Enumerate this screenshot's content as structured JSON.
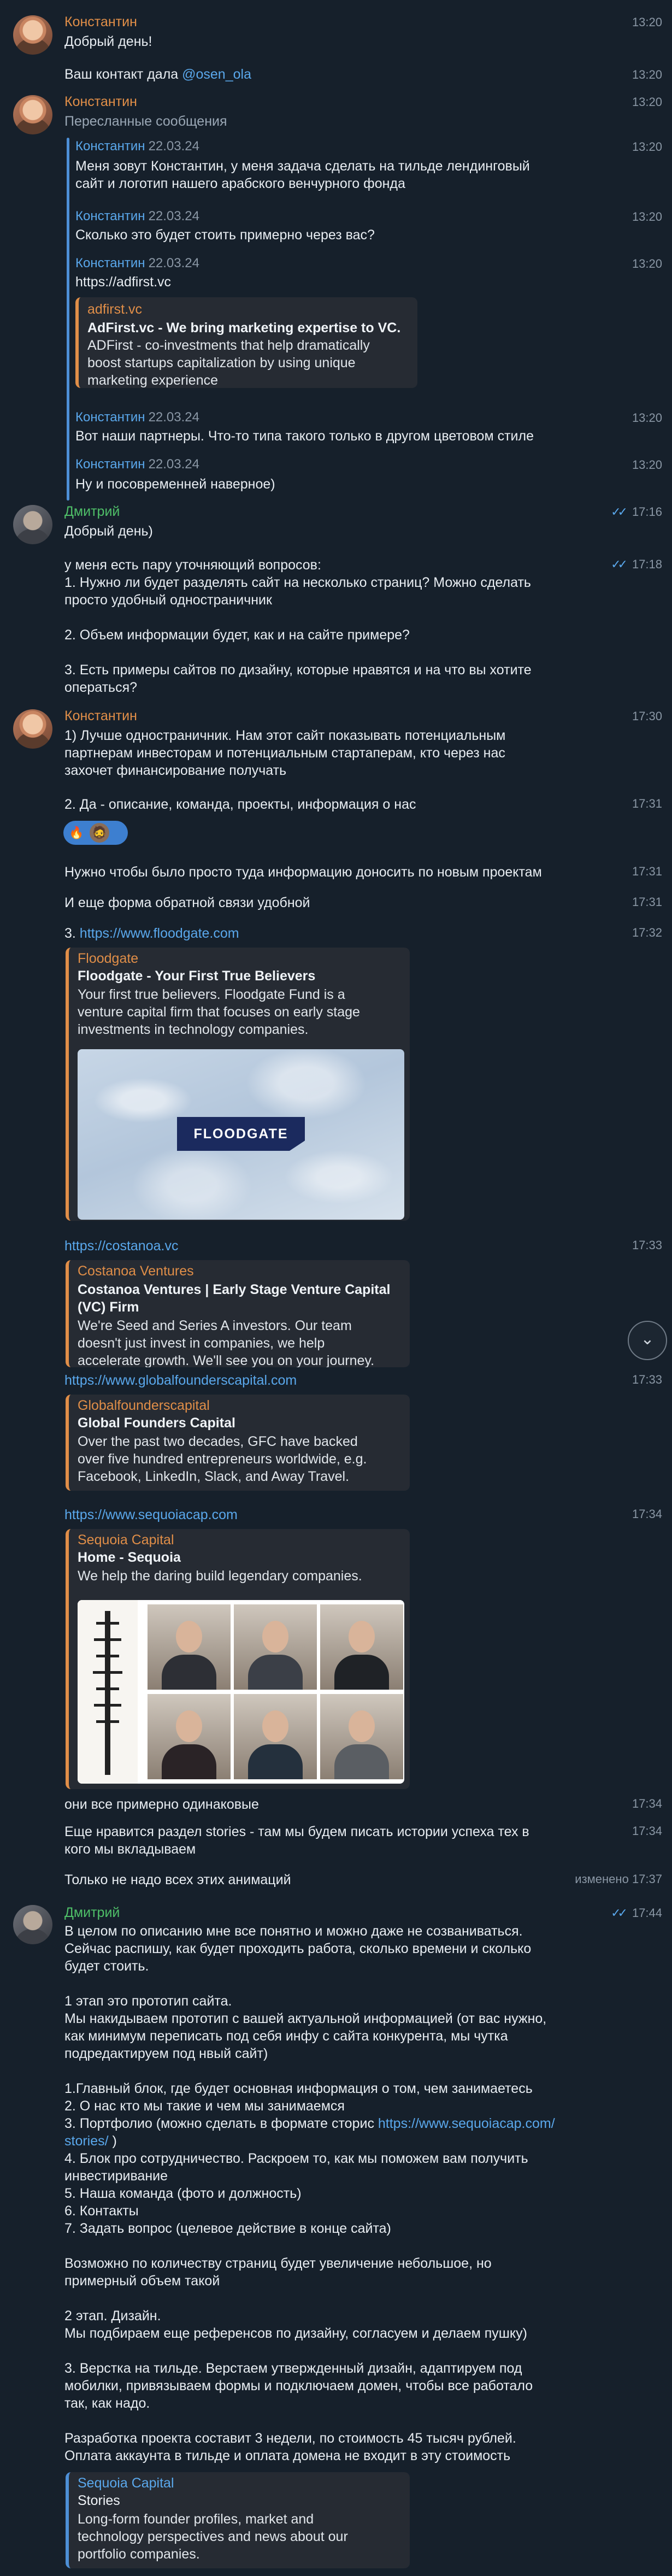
{
  "messages": {
    "m1": {
      "sender": "Константин",
      "time": "13:20",
      "text": "Добрый день!"
    },
    "m2": {
      "prefix": "Ваш контакт дала ",
      "link": "@osen_ola",
      "time": "13:20"
    },
    "m3": {
      "sender": "Константин",
      "time": "13:20",
      "subtitle": "Пересланные сообщения",
      "forwards": [
        {
          "name": "Константин",
          "date": "22.03.24",
          "time": "13:20",
          "text": "Меня зовут Константин, у меня задача сделать на тильде лендинговый\nсайт и логотип нашего арабского венчурного фонда"
        },
        {
          "name": "Константин",
          "date": "22.03.24",
          "time": "13:20",
          "text": "Сколько это будет стоить примерно через вас?"
        },
        {
          "name": "Константин",
          "date": "22.03.24",
          "time": "13:20",
          "link": "https://adfirst.vc",
          "card": {
            "site": "adfirst.vc",
            "title": "AdFirst.vc - We bring marketing expertise to VC.",
            "desc": "ADFirst - co-investments that help dramatically\nboost startups capitalization by using unique\nmarketing experience"
          }
        },
        {
          "name": "Константин",
          "date": "22.03.24",
          "time": "13:20",
          "text": "Вот наши партнеры. Что-то типа такого только в другом цветовом стиле"
        },
        {
          "name": "Константин",
          "date": "22.03.24",
          "time": "13:20",
          "text": "Ну и посовременней наверное)"
        }
      ]
    },
    "m4": {
      "sender": "Дмитрий",
      "time": "17:16",
      "ticks": "✓✓",
      "text": "Добрый день)"
    },
    "m5": {
      "time": "17:18",
      "ticks": "✓✓",
      "text": "у меня есть пару уточняющий вопросов:\n1. Нужно ли будет разделять сайт на несколько страниц? Можно сделать\nпросто удобный одностраничник\n\n2. Объем информации будет, как и на сайте примере?\n\n3. Есть примеры сайтов по дизайну, которые нравятся и на что вы хотите\nоператься?"
    },
    "m6": {
      "sender": "Константин",
      "time": "17:30",
      "text": "1) Лучше одностраничник. Нам этот сайт показывать потенциальным\nпартнерам инвесторам и потенциальным стартаперам, кто через нас\nзахочет финансирование получать"
    },
    "m7": {
      "time": "17:31",
      "text": "2. Да - описание, команда, проекты, информация о нас",
      "reactions": [
        "🔥",
        "🧔"
      ]
    },
    "m8": {
      "time": "17:31",
      "text": "Нужно чтобы было просто туда информацию доносить по новым проектам"
    },
    "m9": {
      "time": "17:31",
      "text": "И еще форма обратной связи удобной"
    },
    "m10": {
      "time": "17:32",
      "prefix": "3. ",
      "link": "https://www.floodgate.com",
      "card": {
        "site": "Floodgate",
        "title": "Floodgate - Your First True Believers",
        "desc": "Your first true believers. Floodgate Fund is a\nventure capital firm that focuses on early stage\ninvestments in technology companies.",
        "logo": "FLOODGATE"
      }
    },
    "m11": {
      "time": "17:33",
      "link": "https://costanoa.vc",
      "card": {
        "site": "Costanoa Ventures",
        "title": "Costanoa Ventures | Early Stage Venture Capital\n(VC) Firm",
        "desc": "We're Seed and Series A investors. Our team\ndoesn't just invest in companies, we help\naccelerate growth. We'll see you on your journey."
      }
    },
    "m12": {
      "time": "17:33",
      "link": "https://www.globalfounderscapital.com",
      "card": {
        "site": "Globalfounderscapital",
        "title": "Global Founders Capital",
        "desc": "Over the past two decades, GFC have backed\nover five hundred entrepreneurs worldwide, e.g.\nFacebook, LinkedIn, Slack, and Away Travel."
      }
    },
    "m13": {
      "time": "17:34",
      "link": "https://www.sequoiacap.com",
      "card": {
        "site": "Sequoia Capital",
        "title": "Home - Sequoia",
        "desc": "We help the daring build legendary companies."
      }
    },
    "m14": {
      "time": "17:34",
      "text": "они все примерно одинаковые"
    },
    "m15": {
      "time": "17:34",
      "text": "Еще нравится раздел stories - там мы будем писать истории успеха тех в\nкого мы вкладываем"
    },
    "m16": {
      "time": "17:37",
      "edited": "изменено",
      "text": "Только не надо всех этих анимаций"
    },
    "m17": {
      "sender": "Дмитрий",
      "time": "17:44",
      "ticks": "✓✓",
      "text_a": "В целом по описанию мне все понятно и можно даже не созваниваться.\nСейчас распишу, как будет проходить работа, сколько времени и сколько\nбудет стоить.\n\n1 этап это прототип сайта.\nМы накидываем прототип с вашей актуальной информацией (от вас нужно,\nкак минимум переписать под себя инфу с сайта конкурента, мы чутка\nподредактируем под нвый сайт)\n\n1.Главный блок, где будет основная информация о том, чем занимаетесь\n2. О нас кто мы такие и чем мы занимаемся\n3. Портфолио (можно сделать в формате сторис ",
      "link": "https://www.sequoiacap.com/\nstories/",
      "text_b": " )\n4. Блок про сотрудничество. Раскроем то, как мы поможем вам получить\nинвестиривание\n5. Наша команда (фото и должность)\n6. Контакты\n7. Задать вопрос (целевое действие в конце сайта)\n\nВозможно по количеству страниц будет увеличение небольшое, но\nпримерный объем такой\n\n2 этап. Дизайн.\nМы подбираем еще референсов по дизайну, согласуем и делаем пушку)\n\n3. Верстка на тильде. Верстаем утвержденный дизайн, адаптируем под\nмобилки, привязываем формы и подключаем домен, чтобы все работало\nтак, как надо.\n\nРазработка проекта составит 3 недели, по стоимость 45 тысяч рублей.\nОплата аккаунта в тильде и оплата домена не входит в эту стоимость",
      "card": {
        "site": "Sequoia Capital",
        "title": "Stories",
        "desc": "Long-form founder profiles, market and\ntechnology perspectives and news about our\nportfolio companies."
      }
    }
  }
}
